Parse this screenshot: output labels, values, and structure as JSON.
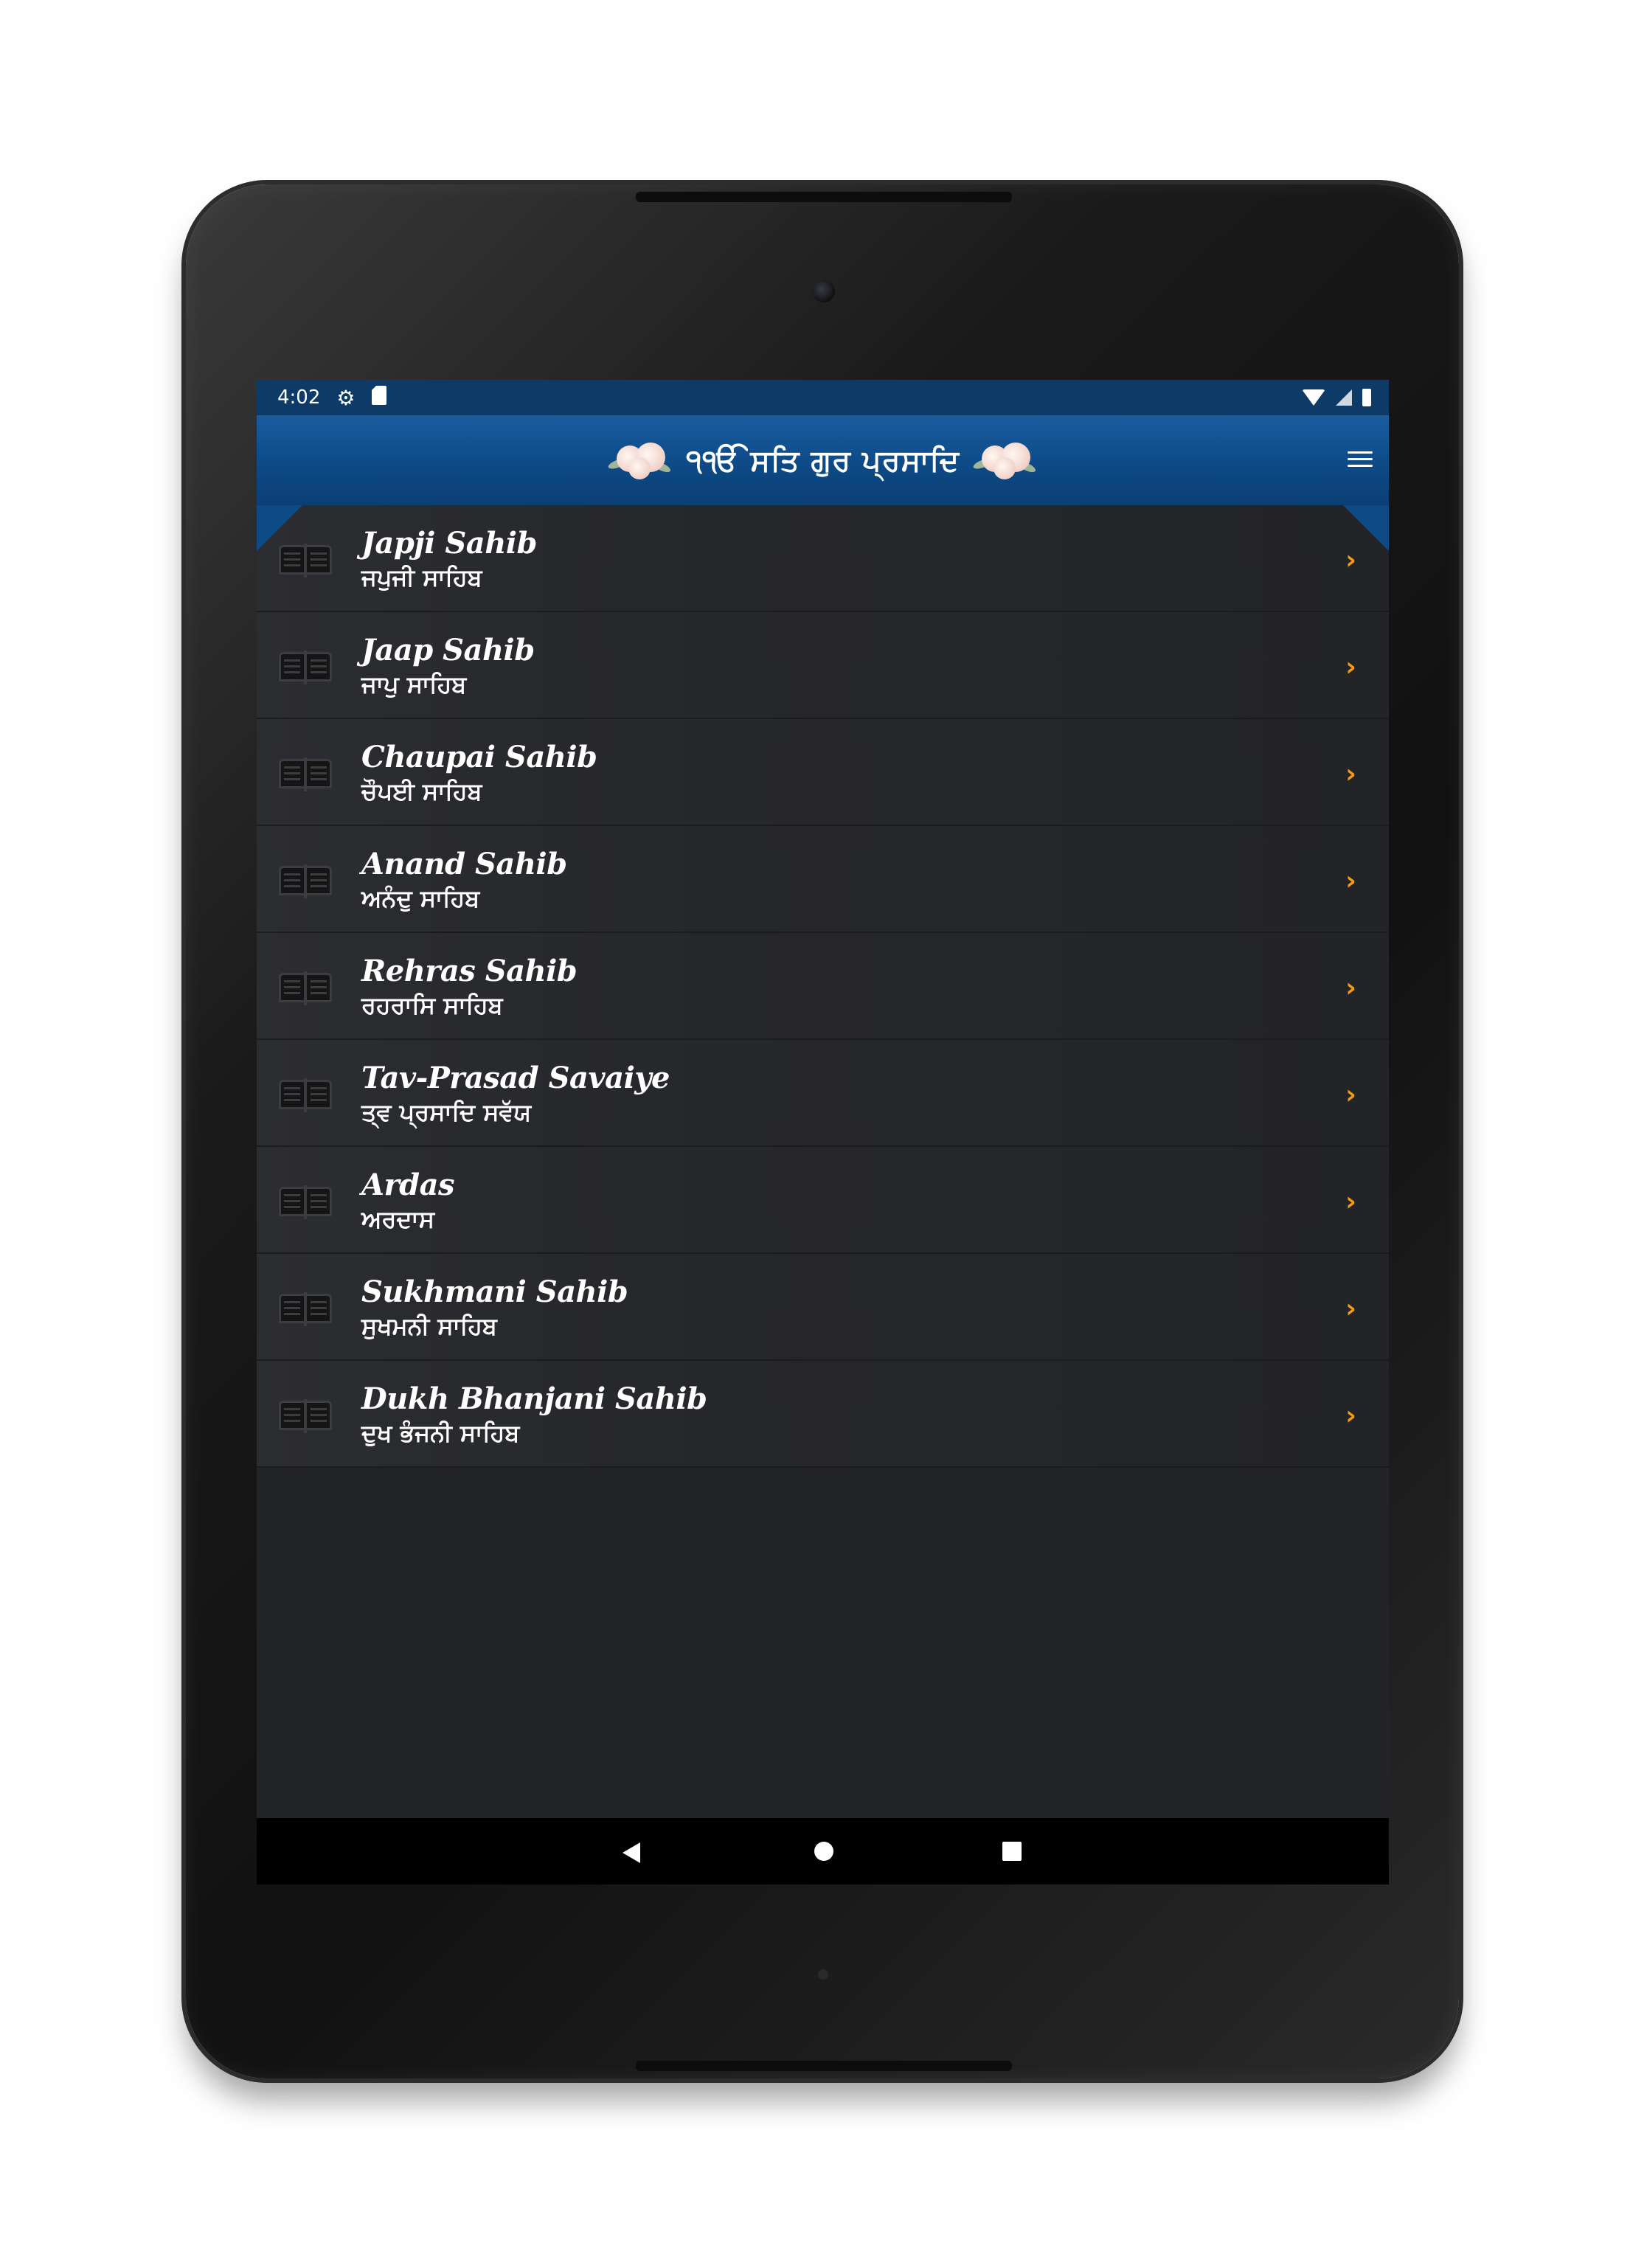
{
  "status_bar": {
    "time": "4:02",
    "icons": [
      "settings-icon",
      "sd-card-icon",
      "wifi-icon",
      "signal-icon",
      "battery-icon"
    ]
  },
  "app_bar": {
    "title": "੧ੴ ਸਤਿ ਗੁਰ ਪ੍ਰਸਾਦਿ",
    "menu_icon": "hamburger-menu-icon",
    "colors": {
      "primary": "#0d4a86",
      "accent": "#f39c12",
      "background": "#232428"
    }
  },
  "banis": [
    {
      "title": "Japji Sahib",
      "subtitle": "ਜਪੁਜੀ ਸਾਹਿਬ"
    },
    {
      "title": "Jaap Sahib",
      "subtitle": "ਜਾਪੁ ਸਾਹਿਬ"
    },
    {
      "title": "Chaupai Sahib",
      "subtitle": "ਚੌਪਈ ਸਾਹਿਬ"
    },
    {
      "title": "Anand Sahib",
      "subtitle": "ਅਨੰਦੁ ਸਾਹਿਬ"
    },
    {
      "title": "Rehras Sahib",
      "subtitle": "ਰਹਰਾਸਿ ਸਾਹਿਬ"
    },
    {
      "title": "Tav-Prasad Savaiye",
      "subtitle": "ਤ੍ਵ ਪ੍ਰਸਾਦਿ ਸਵੱਯ"
    },
    {
      "title": "Ardas",
      "subtitle": "ਅਰਦਾਸ"
    },
    {
      "title": "Sukhmani Sahib",
      "subtitle": "ਸੁਖਮਨੀ ਸਾਹਿਬ"
    },
    {
      "title": "Dukh Bhanjani Sahib",
      "subtitle": "ਦੁਖ ਭੰਜਨੀ ਸਾਹਿਬ"
    }
  ],
  "row_chevron": "›",
  "nav_bar": {
    "icons": [
      "back-icon",
      "home-icon",
      "recents-icon"
    ]
  }
}
